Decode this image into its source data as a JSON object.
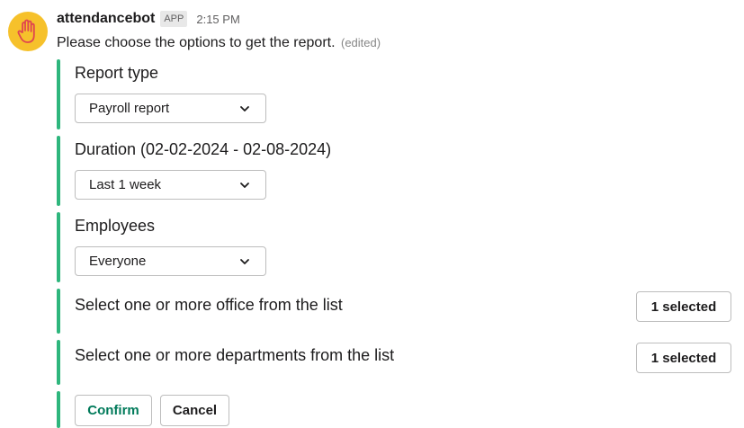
{
  "message": {
    "bot_name": "attendancebot",
    "badge": "APP",
    "time": "2:15 PM",
    "intro": "Please choose the options to get the report.",
    "edited": "(edited)"
  },
  "report_type": {
    "label": "Report type",
    "selected": "Payroll report"
  },
  "duration": {
    "label": "Duration (02-02-2024 - 02-08-2024)",
    "selected": "Last 1 week"
  },
  "employees": {
    "label": "Employees",
    "selected": "Everyone"
  },
  "offices": {
    "label": "Select one or more office from the list",
    "button": "1 selected"
  },
  "departments": {
    "label": "Select one or more departments from the list",
    "button": "1 selected"
  },
  "actions": {
    "confirm": "Confirm",
    "cancel": "Cancel"
  },
  "colors": {
    "accent_bar": "#2eb67d",
    "confirm_text": "#007a5a",
    "avatar_bg": "#f6c12b"
  },
  "icons": {
    "avatar": "raised-hand-icon",
    "dropdown": "chevron-down-icon"
  }
}
